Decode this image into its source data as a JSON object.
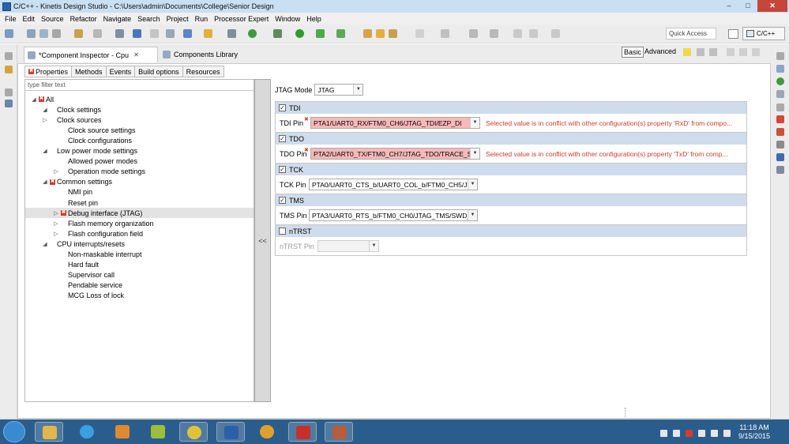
{
  "window": {
    "title": "C/C++ - Kinetis Design Studio - C:\\Users\\admin\\Documents\\College\\Senior Design",
    "app_icon": "eclipse-icon",
    "minimize": "–",
    "maximize": "□",
    "close": "✕"
  },
  "menu": [
    "File",
    "Edit",
    "Source",
    "Refactor",
    "Navigate",
    "Search",
    "Project",
    "Run",
    "Processor Expert",
    "Window",
    "Help"
  ],
  "toolbar": {
    "quick_access_placeholder": "Quick Access",
    "perspective": "C/C++"
  },
  "editor": {
    "tabs": [
      {
        "label": "*Component Inspector - Cpu",
        "close": "✕",
        "active": true
      },
      {
        "label": "Components Library",
        "active": false
      }
    ],
    "mode": {
      "basic": "Basic",
      "advanced": "Advanced"
    },
    "subtabs": [
      "Properties",
      "Methods",
      "Events",
      "Build options",
      "Resources"
    ]
  },
  "tree": {
    "filter_placeholder": "type filter text",
    "collapse_button": "<<",
    "nodes": [
      {
        "label": "All",
        "twisty": "◢",
        "error": true
      },
      {
        "label": "Clock settings",
        "twisty": "◢"
      },
      {
        "label": "Clock sources",
        "twisty": "▷"
      },
      {
        "label": "Clock source settings"
      },
      {
        "label": "Clock configurations"
      },
      {
        "label": "Low power mode settings",
        "twisty": "◢"
      },
      {
        "label": "Allowed power modes"
      },
      {
        "label": "Operation mode settings",
        "twisty": "▷"
      },
      {
        "label": "Common settings",
        "twisty": "◢",
        "error": true
      },
      {
        "label": "NMI pin"
      },
      {
        "label": "Reset pin"
      },
      {
        "label": "Debug interface (JTAG)",
        "twisty": "▷",
        "error": true,
        "selected": true
      },
      {
        "label": "Flash memory organization",
        "twisty": "▷"
      },
      {
        "label": "Flash configuration field",
        "twisty": "▷"
      },
      {
        "label": "CPU interrupts/resets",
        "twisty": "◢"
      },
      {
        "label": "Non-maskable interrupt"
      },
      {
        "label": "Hard fault"
      },
      {
        "label": "Supervisor call"
      },
      {
        "label": "Pendable service"
      },
      {
        "label": "MCG Loss of lock"
      }
    ]
  },
  "props": {
    "jtag_mode_label": "JTAG Mode",
    "jtag_mode_value": "JTAG",
    "sections": [
      {
        "name": "TDI",
        "checked": true,
        "pin_label": "TDI Pin",
        "pin_value": "PTA1/UART0_RX/FTM0_CH6/JTAG_TDI/EZP_DI",
        "error": true,
        "conflict": "Selected value is in conflict with other configuration(s) property 'RxD' from compo..."
      },
      {
        "name": "TDO",
        "checked": true,
        "pin_label": "TDO Pin",
        "pin_value": "PTA2/UART0_TX/FTM0_CH7/JTAG_TDO/TRACE_S\\",
        "error": true,
        "conflict": "Selected value is in conflict with other configuration(s) property 'TxD' from comp..."
      },
      {
        "name": "TCK",
        "checked": true,
        "pin_label": "TCK Pin",
        "pin_value": "PTA0/UART0_CTS_b/UART0_COL_b/FTM0_CH5/JT",
        "error": false
      },
      {
        "name": "TMS",
        "checked": true,
        "pin_label": "TMS Pin",
        "pin_value": "PTA3/UART0_RTS_b/FTM0_CH0/JTAG_TMS/SWD_I",
        "error": false
      },
      {
        "name": "nTRST",
        "checked": false,
        "pin_label": "nTRST Pin",
        "pin_value": "",
        "error": false,
        "disabled": true
      }
    ],
    "check_mark": "✓",
    "error_marker": "✖"
  },
  "taskbar": {
    "time": "11:18 AM",
    "date": "9/15/2015"
  }
}
